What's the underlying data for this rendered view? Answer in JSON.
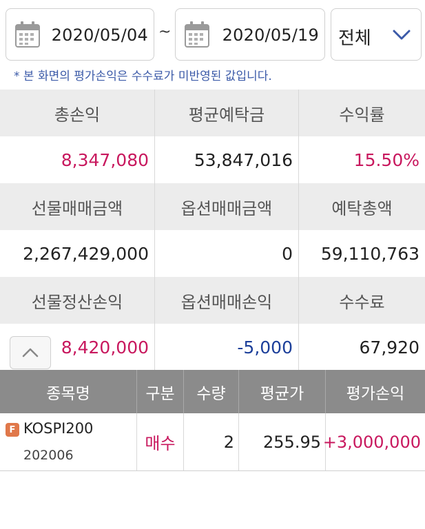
{
  "filter": {
    "start_date": "2020/05/04",
    "separator": "~",
    "end_date": "2020/05/19",
    "category": "전체"
  },
  "note": "* 본 화면의 평가손익은 수수료가 미반영된 값입니다.",
  "summary": {
    "row1": {
      "labels": [
        "총손익",
        "평균예탁금",
        "수익률"
      ],
      "values": [
        "8,347,080",
        "53,847,016",
        "15.50%"
      ]
    },
    "row2": {
      "labels": [
        "선물매매금액",
        "옵션매매금액",
        "예탁총액"
      ],
      "values": [
        "2,267,429,000",
        "0",
        "59,110,763"
      ]
    },
    "row3": {
      "labels": [
        "선물정산손익",
        "옵션매매손익",
        "수수료"
      ],
      "values": [
        "8,420,000",
        "-5,000",
        "67,920"
      ]
    }
  },
  "positions": {
    "headers": [
      "종목명",
      "구분",
      "수량",
      "평균가",
      "평가손익"
    ],
    "rows": [
      {
        "badge": "F",
        "name": "KOSPI200",
        "code": "202006",
        "side": "매수",
        "qty": "2",
        "avg_price": "255.95",
        "pnl": "+3,000,000"
      }
    ]
  },
  "colors": {
    "positive": "#c8185e",
    "negative": "#1c3f9a",
    "header_bg": "#ececec",
    "table_header_bg": "#8b8b8b"
  }
}
